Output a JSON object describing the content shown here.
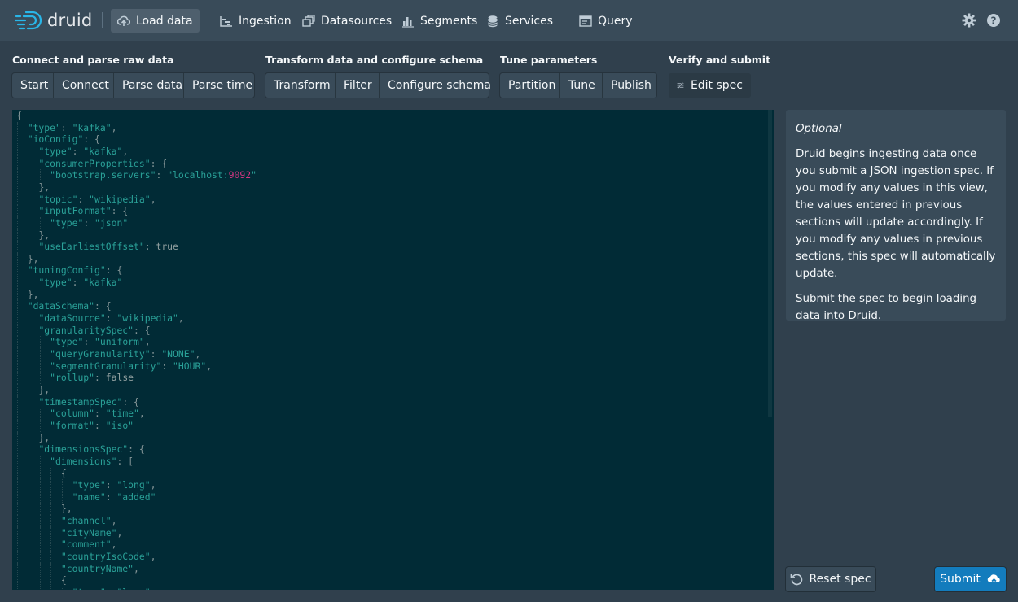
{
  "nav": {
    "logo_text": "druid",
    "items": [
      {
        "label": "Load data",
        "icon": "cloud-upload-icon"
      },
      {
        "label": "Ingestion",
        "icon": "gantt-chart-icon"
      },
      {
        "label": "Datasources",
        "icon": "multi-select-icon"
      },
      {
        "label": "Segments",
        "icon": "stacked-chart-icon"
      },
      {
        "label": "Services",
        "icon": "database-icon"
      },
      {
        "label": "Query",
        "icon": "application-icon"
      }
    ],
    "settings_icon": "cog-icon",
    "help_icon": "help-icon"
  },
  "steps": [
    {
      "title": "Connect and parse raw data",
      "buttons": [
        "Start",
        "Connect",
        "Parse data",
        "Parse time"
      ]
    },
    {
      "title": "Transform data and configure schema",
      "buttons": [
        "Transform",
        "Filter",
        "Configure schema"
      ]
    },
    {
      "title": "Tune parameters",
      "buttons": [
        "Partition",
        "Tune",
        "Publish"
      ]
    },
    {
      "title": "Verify and submit",
      "buttons": [
        "Edit spec"
      ]
    }
  ],
  "active_step": "Edit spec",
  "editor": {
    "lines": [
      "{",
      "  \"type\": \"kafka\",",
      "  \"ioConfig\": {",
      "    \"type\": \"kafka\",",
      "    \"consumerProperties\": {",
      "      \"bootstrap.servers\": \"localhost:9092\"",
      "    },",
      "    \"topic\": \"wikipedia\",",
      "    \"inputFormat\": {",
      "      \"type\": \"json\"",
      "    },",
      "    \"useEarliestOffset\": true",
      "  },",
      "  \"tuningConfig\": {",
      "    \"type\": \"kafka\"",
      "  },",
      "  \"dataSchema\": {",
      "    \"dataSource\": \"wikipedia\",",
      "    \"granularitySpec\": {",
      "      \"type\": \"uniform\",",
      "      \"queryGranularity\": \"NONE\",",
      "      \"segmentGranularity\": \"HOUR\",",
      "      \"rollup\": false",
      "    },",
      "    \"timestampSpec\": {",
      "      \"column\": \"time\",",
      "      \"format\": \"iso\"",
      "    },",
      "    \"dimensionsSpec\": {",
      "      \"dimensions\": [",
      "        {",
      "          \"type\": \"long\",",
      "          \"name\": \"added\"",
      "        },",
      "        \"channel\",",
      "        \"cityName\",",
      "        \"comment\",",
      "        \"countryIsoCode\",",
      "        \"countryName\",",
      "        {",
      "          \"type\": \"long\","
    ]
  },
  "info": {
    "heading": "Optional",
    "paragraph1": "Druid begins ingesting data once you submit a JSON ingestion spec. If you modify any values in this view, the values entered in previous sections will update accordingly. If you modify any values in previous sections, this spec will automatically update.",
    "paragraph2": "Submit the spec to begin loading data into Druid."
  },
  "footer": {
    "reset_label": "Reset spec",
    "submit_label": "Submit"
  },
  "colors": {
    "submit_accent": "#137cbd",
    "editor_bg": "#012b36",
    "string": "#2aa198",
    "number": "#d33682"
  }
}
